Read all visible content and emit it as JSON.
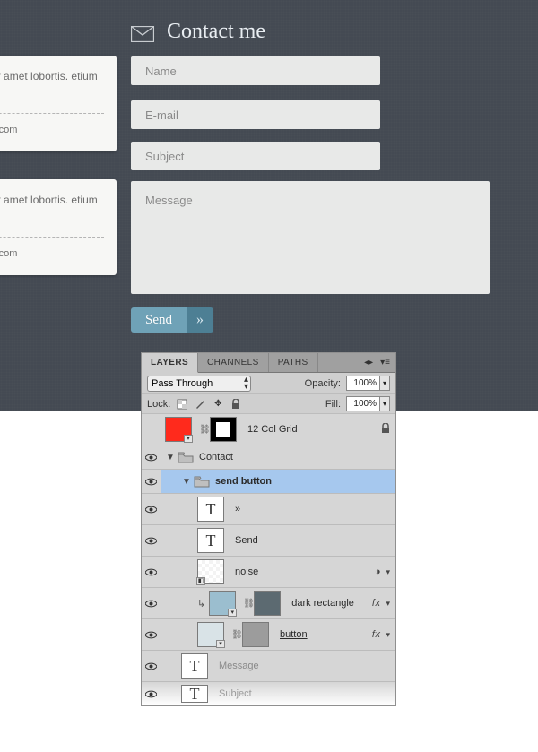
{
  "heading": "Contact me",
  "cards": [
    {
      "body": "pia nostra, per amet lobortis. etium placerat.",
      "link": "design-instruct.com"
    },
    {
      "body": "pia nostra, per amet lobortis. etium placerat.",
      "link": "design-instruct.com"
    }
  ],
  "form": {
    "name_ph": "Name",
    "email_ph": "E-mail",
    "subject_ph": "Subject",
    "message_ph": "Message",
    "send_label": "Send",
    "send_arrow": "»"
  },
  "ps": {
    "tabs": {
      "layers": "LAYERS",
      "channels": "CHANNELS",
      "paths": "PATHS"
    },
    "blend_mode": "Pass Through",
    "opacity_label": "Opacity:",
    "opacity_value": "100%",
    "lock_label": "Lock:",
    "fill_label": "Fill:",
    "fill_value": "100%",
    "layers": {
      "grid": "12 Col Grid",
      "contact": "Contact",
      "send_button": "send button",
      "arrow": "»",
      "send": "Send",
      "noise": "noise",
      "dark_rect": "dark rectangle",
      "button": "button",
      "message": "Message",
      "subject": "Subject"
    },
    "fx": "fx"
  }
}
